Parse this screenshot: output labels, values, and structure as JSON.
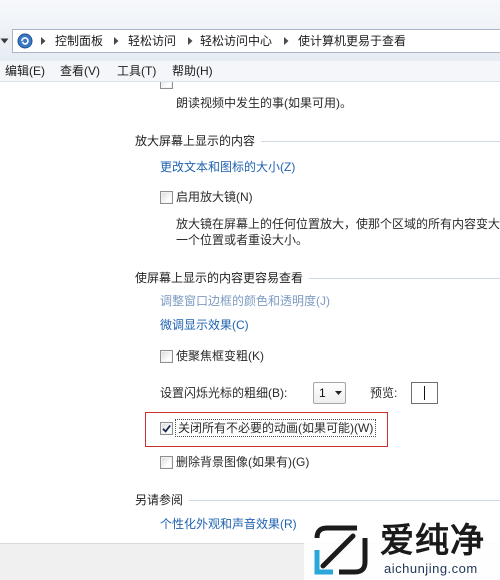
{
  "breadcrumb": [
    "控制面板",
    "轻松访问",
    "轻松访问中心",
    "使计算机更易于查看"
  ],
  "menu": [
    "编辑(E)",
    "查看(V)",
    "工具(T)",
    "帮助(H)"
  ],
  "audio_description": {
    "description": "朗读视频中发生的事(如果可用)。"
  },
  "magnify_section": {
    "title": "放大屏幕上显示的内容",
    "text_size_link": "更改文本和图标的大小(Z)",
    "magnifier": {
      "label": "启用放大镜(N)",
      "checked": false,
      "description": [
        "放大镜在屏幕上的任何位置放大，使那个区域的所有内容变大",
        "一个位置或者重设大小。"
      ]
    }
  },
  "easier_section": {
    "title": "使屏幕上显示的内容更容易查看",
    "window_border_link": "调整窗口边框的颜色和透明度(J)",
    "display_tuning_link": "微调显示效果(C)",
    "thick_focus": {
      "label": "使聚焦框变粗(K)",
      "checked": false
    },
    "cursor_thickness": {
      "label": "设置闪烁光标的粗细(B):",
      "value": "1",
      "preview_label": "预览:"
    },
    "disable_animations": {
      "label": "关闭所有不必要的动画(如果可能)(W)",
      "checked": true
    },
    "remove_backgrounds": {
      "label": "删除背景图像(如果有)(G)",
      "checked": false
    }
  },
  "see_also_section": {
    "title": "另请参阅",
    "personalization_link": "个性化外观和声音效果(R)"
  },
  "watermark": {
    "brand": "爱纯净",
    "site": "aichunjing.com"
  },
  "colors": {
    "link": "#1f62b0",
    "link_muted": "#7d9bc3",
    "text": "#2b2b2b",
    "section_rule": "#cfd9e3",
    "highlight_box": "#cc2f2f",
    "bottom_bar": "#f0f0f0"
  },
  "icons": {
    "recent_pages": "chevron-down-icon",
    "location": "ease-of-access-icon",
    "breadcrumb_separator": "chevron-right-icon",
    "dropdown": "chevron-down-icon",
    "checkbox_mark": "checkmark-icon",
    "watermark_logo": "aichunjing-logo-icon"
  }
}
